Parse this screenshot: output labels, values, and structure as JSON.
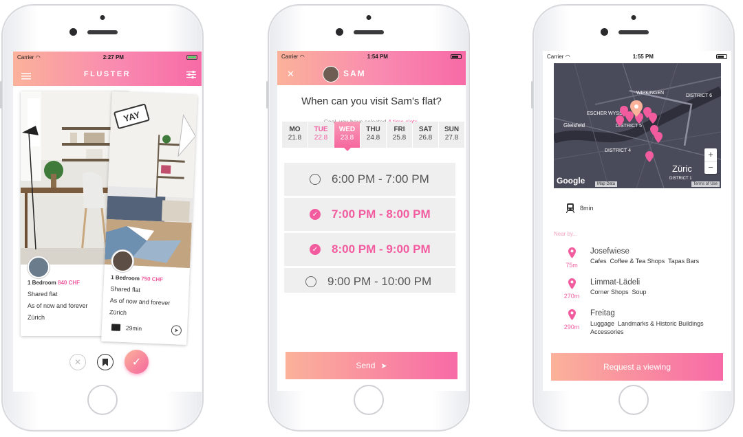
{
  "phone1": {
    "status": {
      "carrier": "Carrier",
      "time": "2:27 PM"
    },
    "title": "FLUSTER",
    "card_back": {
      "bedrooms": "1 Bedroom",
      "price": "840 CHF",
      "type": "Shared flat",
      "availability": "As of now and forever",
      "city": "Zürich"
    },
    "card_front": {
      "badge": "YAY",
      "bedrooms": "1 Bedroom",
      "price": "750 CHF",
      "type": "Shared flat",
      "availability": "As of now and forever",
      "city": "Zürich",
      "commute": "29min"
    }
  },
  "phone2": {
    "status": {
      "carrier": "Carrier",
      "time": "1:54 PM"
    },
    "contact_name": "SAM",
    "question": "When can you visit Sam's flat?",
    "selected_prefix": "Cool, you have selected",
    "selected_count": "4 time slots",
    "selected_suffix": ".",
    "days": [
      {
        "name": "MO",
        "date": "21.8"
      },
      {
        "name": "TUE",
        "date": "22.8"
      },
      {
        "name": "WED",
        "date": "23.8"
      },
      {
        "name": "THU",
        "date": "24.8"
      },
      {
        "name": "FRI",
        "date": "25.8"
      },
      {
        "name": "SAT",
        "date": "26.8"
      },
      {
        "name": "SUN",
        "date": "27.8"
      }
    ],
    "slots": [
      {
        "label": "6:00 PM - 7:00 PM",
        "selected": false
      },
      {
        "label": "7:00 PM - 8:00 PM",
        "selected": true
      },
      {
        "label": "8:00 PM - 9:00 PM",
        "selected": true
      },
      {
        "label": "9:00 PM - 10:00 PM",
        "selected": false
      }
    ],
    "send_label": "Send"
  },
  "phone3": {
    "status": {
      "carrier": "Carrier",
      "time": "1:55 PM"
    },
    "map": {
      "labels": [
        "WIPKINGEN",
        "DISTRICT 6",
        "ESCHER WYSS",
        "DISTRICT 5",
        "Gleisfeld",
        "DISTRICT 4",
        "Züric",
        "DISTRICT 1"
      ],
      "google": "Google",
      "mapdata": "Map Data",
      "terms": "Terms of Use",
      "zoom_in": "+",
      "zoom_out": "−"
    },
    "transit_time": "8min",
    "nearby_heading": "Near by...",
    "places": [
      {
        "distance": "75m",
        "name": "Josefwiese",
        "tags": [
          "Cafes",
          "Coffee & Tea Shops",
          "Tapas Bars"
        ]
      },
      {
        "distance": "270m",
        "name": "Limmat-Lädeli",
        "tags": [
          "Corner Shops",
          "Soup"
        ]
      },
      {
        "distance": "290m",
        "name": "Freitag",
        "tags": [
          "Luggage",
          "Landmarks & Historic Buildings",
          "Accessories"
        ]
      }
    ],
    "cta": "Request a viewing"
  },
  "colors": {
    "accent": "#f25c9f",
    "gradient_start": "#fbb29a",
    "gradient_end": "#f76aa6",
    "map_bg": "#4a4b5a"
  }
}
